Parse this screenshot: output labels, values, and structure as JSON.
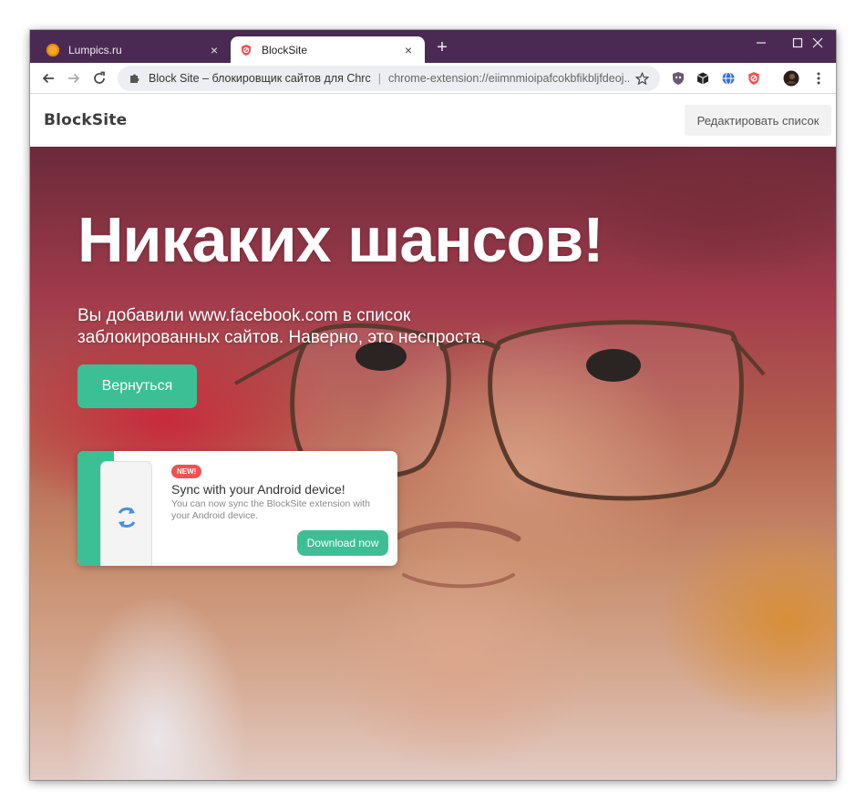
{
  "browser": {
    "tabs": [
      {
        "title": "Lumpics.ru",
        "close": "×"
      },
      {
        "title": "BlockSite",
        "close": "×"
      }
    ],
    "new_tab": "+",
    "omnibox": {
      "site_name": "Block Site – блокировщик сайтов для Chrc",
      "separator": "|",
      "url": "chrome-extension://eiimnmioipafcokbfikbljfdeoj..."
    },
    "accent_color": "#4a2a53"
  },
  "site": {
    "logo": "BlockSite",
    "edit_list_button": "Редактировать список"
  },
  "hero": {
    "headline": "Никаких шансов!",
    "subtext": "Вы добавили www.facebook.com в список заблокированных сайтов. Наверно, это неспроста.",
    "back_button": "Вернуться",
    "button_color": "#3dbf96"
  },
  "promo_card": {
    "badge": "NEW!",
    "title": "Sync with your Android device!",
    "description": "You can now sync the BlockSite extension with your Android device.",
    "download_button": "Download now",
    "icon": "sync-icon"
  }
}
